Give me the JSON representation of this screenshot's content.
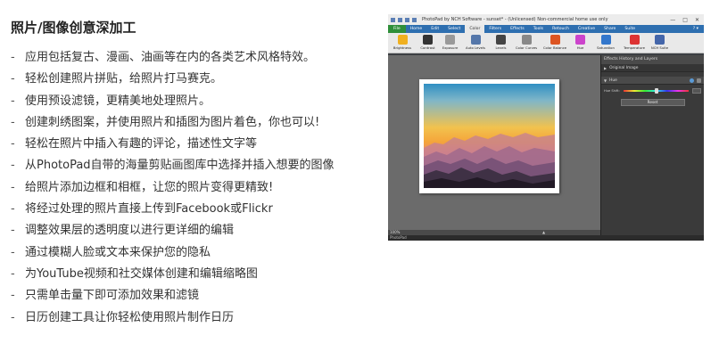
{
  "title": "照片/图像创意深加工",
  "features": [
    "应用包括复古、漫画、油画等在内的各类艺术风格特效。",
    "轻松创建照片拼贴，给照片打马赛克。",
    "使用预设滤镜，更精美地处理照片。",
    "创建刺绣图案，并使用照片和插图为图片着色，你也可以!",
    "轻松在照片中插入有趣的评论，描述性文字等",
    "从PhotoPad自带的海量剪贴画图库中选择并插入想要的图像",
    "给照片添加边框和相框，让您的照片变得更精致!",
    "将经过处理的照片直接上传到Facebook或Flickr",
    "调整效果层的透明度以进行更详细的编辑",
    "通过模糊人脸或文本来保护您的隐私",
    "为YouTube视频和社交媒体创建和编辑缩略图",
    "只需单击量下即可添加效果和滤镜",
    "日历创建工具让你轻松使用照片制作日历"
  ],
  "app": {
    "window_title": "PhotoPad by NCH Software - sunset* - (Unlicensed) Non-commercial home use only",
    "win_buttons": [
      "—",
      "□",
      "✕"
    ],
    "menu": [
      "File",
      "Home",
      "Edit",
      "Select",
      "Color",
      "Filters",
      "Effects",
      "Tools",
      "Retouch",
      "Creative",
      "Share",
      "Suite"
    ],
    "active_menu": "Color",
    "help_label": "? ▾",
    "ribbon": [
      {
        "label": "Brightness",
        "color": "#f0b020"
      },
      {
        "label": "Contrast",
        "color": "#333333"
      },
      {
        "label": "Exposure",
        "color": "#999999"
      },
      {
        "label": "Auto Levels",
        "color": "#5577aa"
      },
      {
        "label": "Levels",
        "color": "#444444"
      },
      {
        "label": "Color Curves",
        "color": "#888888"
      },
      {
        "label": "Color Balance",
        "color": "#dd5522"
      },
      {
        "label": "Hue",
        "color": "#cc44cc"
      },
      {
        "label": "Saturation",
        "color": "#3377cc"
      },
      {
        "label": "Temperature",
        "color": "#dd3333"
      },
      {
        "label": "NCH Suite",
        "color": "#4466aa"
      }
    ],
    "panel": {
      "header": "Effects History and Layers",
      "original_image": "Original Image",
      "hue_section": "Hue",
      "hue_shift_label": "Hue Shift:",
      "hue_shift": 0.5,
      "reset_label": "Reset"
    },
    "zoom_text": "100%",
    "zoom_caret": "▲",
    "status_text": "PhotoPad"
  }
}
